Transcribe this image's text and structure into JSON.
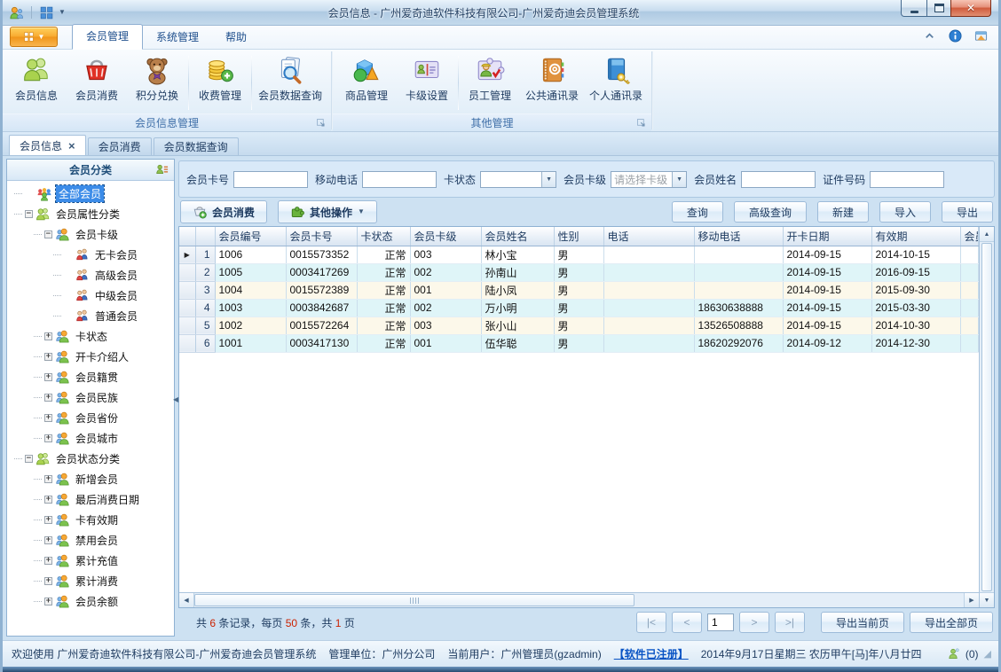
{
  "titlebar": {
    "title": "会员信息 - 广州爱奇迪软件科技有限公司-广州爱奇迪会员管理系统"
  },
  "colors": {
    "app_button_orange": "#f8a92f",
    "tree_selection_blue": "#3c8ce8",
    "row_stripe_cream": "#fcf8ea",
    "row_stripe_cyan": "#dff5f8",
    "summary_number_red": "#cc2200",
    "link_blue": "#0853c4"
  },
  "ribbon": {
    "tabs": [
      {
        "label": "会员管理",
        "active": true
      },
      {
        "label": "系统管理",
        "active": false
      },
      {
        "label": "帮助",
        "active": false
      }
    ],
    "groups": [
      {
        "label": "会员信息管理",
        "items": [
          {
            "label": "会员信息",
            "icon": "members"
          },
          {
            "label": "会员消费",
            "icon": "basket"
          },
          {
            "label": "积分兑换",
            "icon": "teddy",
            "sep_after": true
          },
          {
            "label": "收费管理",
            "icon": "coins",
            "sep_after": true
          },
          {
            "label": "会员数据查询",
            "icon": "doc-search"
          }
        ]
      },
      {
        "label": "其他管理",
        "items": [
          {
            "label": "商品管理",
            "icon": "shapes"
          },
          {
            "label": "卡级设置",
            "icon": "card",
            "sep_after": true
          },
          {
            "label": "员工管理",
            "icon": "puzzle-user"
          },
          {
            "label": "公共通讯录",
            "icon": "addressbook"
          },
          {
            "label": "个人通讯录",
            "icon": "bluebook-key"
          }
        ]
      }
    ]
  },
  "doc_tabs": [
    {
      "label": "会员信息",
      "active": true,
      "closable": true
    },
    {
      "label": "会员消费",
      "active": false
    },
    {
      "label": "会员数据查询",
      "active": false
    }
  ],
  "sidebar": {
    "header": "会员分类",
    "tree": [
      {
        "label": "全部会员",
        "level": 0,
        "icon": "group",
        "selected": true
      },
      {
        "label": "会员属性分类",
        "level": 0,
        "icon": "users-green",
        "exp": "minus"
      },
      {
        "label": "会员卡级",
        "level": 1,
        "icon": "users-orange",
        "exp": "minus"
      },
      {
        "label": "无卡会员",
        "level": 2,
        "icon": "member"
      },
      {
        "label": "高级会员",
        "level": 2,
        "icon": "member"
      },
      {
        "label": "中级会员",
        "level": 2,
        "icon": "member"
      },
      {
        "label": "普通会员",
        "level": 2,
        "icon": "member"
      },
      {
        "label": "卡状态",
        "level": 1,
        "icon": "users-orange",
        "exp": "plus"
      },
      {
        "label": "开卡介绍人",
        "level": 1,
        "icon": "users-orange",
        "exp": "plus"
      },
      {
        "label": "会员籍贯",
        "level": 1,
        "icon": "users-orange",
        "exp": "plus"
      },
      {
        "label": "会员民族",
        "level": 1,
        "icon": "users-orange",
        "exp": "plus"
      },
      {
        "label": "会员省份",
        "level": 1,
        "icon": "users-orange",
        "exp": "plus"
      },
      {
        "label": "会员城市",
        "level": 1,
        "icon": "users-orange",
        "exp": "plus"
      },
      {
        "label": "会员状态分类",
        "level": 0,
        "icon": "users-green",
        "exp": "minus"
      },
      {
        "label": "新增会员",
        "level": 1,
        "icon": "users-orange",
        "exp": "plus"
      },
      {
        "label": "最后消费日期",
        "level": 1,
        "icon": "users-orange",
        "exp": "plus"
      },
      {
        "label": "卡有效期",
        "level": 1,
        "icon": "users-orange",
        "exp": "plus"
      },
      {
        "label": "禁用会员",
        "level": 1,
        "icon": "users-orange",
        "exp": "plus"
      },
      {
        "label": "累计充值",
        "level": 1,
        "icon": "users-orange",
        "exp": "plus"
      },
      {
        "label": "累计消费",
        "level": 1,
        "icon": "users-orange",
        "exp": "plus"
      },
      {
        "label": "会员余额",
        "level": 1,
        "icon": "users-orange",
        "exp": "plus"
      }
    ]
  },
  "filters": {
    "fields": [
      {
        "label": "会员卡号",
        "type": "text",
        "value": ""
      },
      {
        "label": "移动电话",
        "type": "text",
        "value": ""
      },
      {
        "label": "卡状态",
        "type": "select",
        "value": "",
        "placeholder": false
      },
      {
        "label": "会员卡级",
        "type": "select",
        "value": "请选择卡级",
        "placeholder": true
      },
      {
        "label": "会员姓名",
        "type": "text",
        "value": ""
      },
      {
        "label": "证件号码",
        "type": "text",
        "value": ""
      }
    ]
  },
  "toolbar": {
    "left": [
      {
        "label": "会员消费",
        "icon": "basket-add",
        "dropdown": false
      },
      {
        "label": "其他操作",
        "icon": "puzzle-green",
        "dropdown": true
      }
    ],
    "right": [
      {
        "label": "查询"
      },
      {
        "label": "高级查询"
      },
      {
        "label": "新建"
      },
      {
        "label": "导入"
      },
      {
        "label": "导出"
      }
    ]
  },
  "table": {
    "columns": [
      "会员编号",
      "会员卡号",
      "卡状态",
      "会员卡级",
      "会员姓名",
      "性别",
      "电话",
      "移动电话",
      "开卡日期",
      "有效期",
      "会员"
    ],
    "rows": [
      {
        "num": "1",
        "member_id": "1006",
        "card_no": "0015573352",
        "card_status": "正常",
        "card_level": "003",
        "name": "林小宝",
        "gender": "男",
        "phone": "",
        "mobile": "",
        "open_date": "2014-09-15",
        "valid_until": "2014-10-15",
        "extra": "",
        "current": true
      },
      {
        "num": "2",
        "member_id": "1005",
        "card_no": "0003417269",
        "card_status": "正常",
        "card_level": "002",
        "name": "孙南山",
        "gender": "男",
        "phone": "",
        "mobile": "",
        "open_date": "2014-09-15",
        "valid_until": "2016-09-15",
        "extra": "",
        "current": false
      },
      {
        "num": "3",
        "member_id": "1004",
        "card_no": "0015572389",
        "card_status": "正常",
        "card_level": "001",
        "name": "陆小凤",
        "gender": "男",
        "phone": "",
        "mobile": "",
        "open_date": "2014-09-15",
        "valid_until": "2015-09-30",
        "extra": "",
        "current": false
      },
      {
        "num": "4",
        "member_id": "1003",
        "card_no": "0003842687",
        "card_status": "正常",
        "card_level": "002",
        "name": "万小明",
        "gender": "男",
        "phone": "",
        "mobile": "18630638888",
        "open_date": "2014-09-15",
        "valid_until": "2015-03-30",
        "extra": "",
        "current": false
      },
      {
        "num": "5",
        "member_id": "1002",
        "card_no": "0015572264",
        "card_status": "正常",
        "card_level": "003",
        "name": "张小山",
        "gender": "男",
        "phone": "",
        "mobile": "13526508888",
        "open_date": "2014-09-15",
        "valid_until": "2014-10-30",
        "extra": "",
        "current": false
      },
      {
        "num": "6",
        "member_id": "1001",
        "card_no": "0003417130",
        "card_status": "正常",
        "card_level": "001",
        "name": "伍华聪",
        "gender": "男",
        "phone": "",
        "mobile": "18620292076",
        "open_date": "2014-09-12",
        "valid_until": "2014-12-30",
        "extra": "",
        "current": false
      }
    ]
  },
  "pager": {
    "summary_parts": [
      {
        "text": "共 "
      },
      {
        "text": "6",
        "highlight": true
      },
      {
        "text": " 条记录，每页 "
      },
      {
        "text": "50",
        "highlight": true
      },
      {
        "text": " 条，共 "
      },
      {
        "text": "1",
        "highlight": true
      },
      {
        "text": " 页"
      }
    ],
    "nav": {
      "first": "|<",
      "prev": "<",
      "page": "1",
      "next": ">",
      "last": ">|"
    },
    "export_current": "导出当前页",
    "export_all": "导出全部页"
  },
  "statusbar": {
    "welcome": "欢迎使用 广州爱奇迪软件科技有限公司-广州爱奇迪会员管理系统",
    "org": "管理单位：广州分公司",
    "user": "当前用户：广州管理员(gzadmin)",
    "license": "【软件已注册】",
    "date": "2014年9月17日星期三 农历甲午[马]年八月廿四",
    "msg_count": "(0)"
  }
}
